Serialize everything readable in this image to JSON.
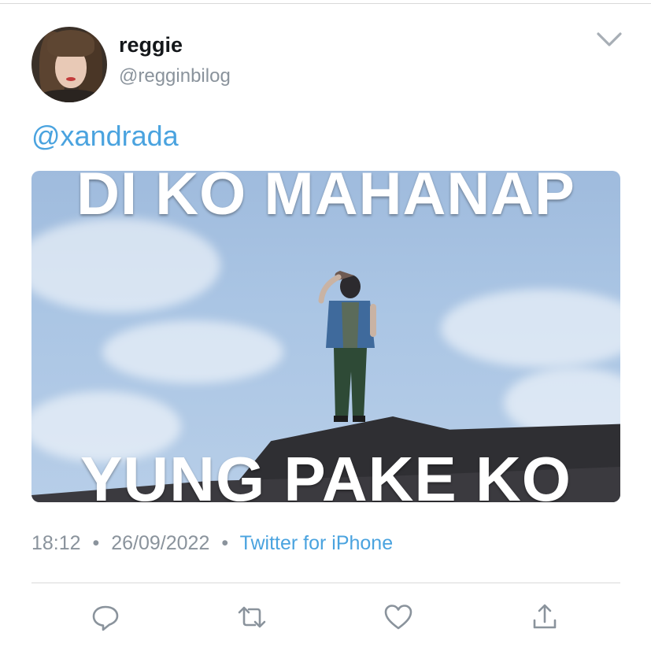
{
  "tweet": {
    "author": {
      "name": "reggie",
      "handle": "@regginbilog"
    },
    "mention": "@xandrada",
    "media": {
      "top_text": "DI KO MAHANAP",
      "bottom_text": "YUNG PAKE KO"
    },
    "time": "18:12",
    "separator": "•",
    "date": "26/09/2022",
    "source": "Twitter for iPhone"
  },
  "icons": {
    "menu": "chevron-down-icon",
    "reply": "reply-icon",
    "retweet": "retweet-icon",
    "like": "heart-icon",
    "share": "share-icon"
  },
  "colors": {
    "link": "#4aa3df",
    "icon": "#8a939c",
    "text": "#14171a"
  }
}
